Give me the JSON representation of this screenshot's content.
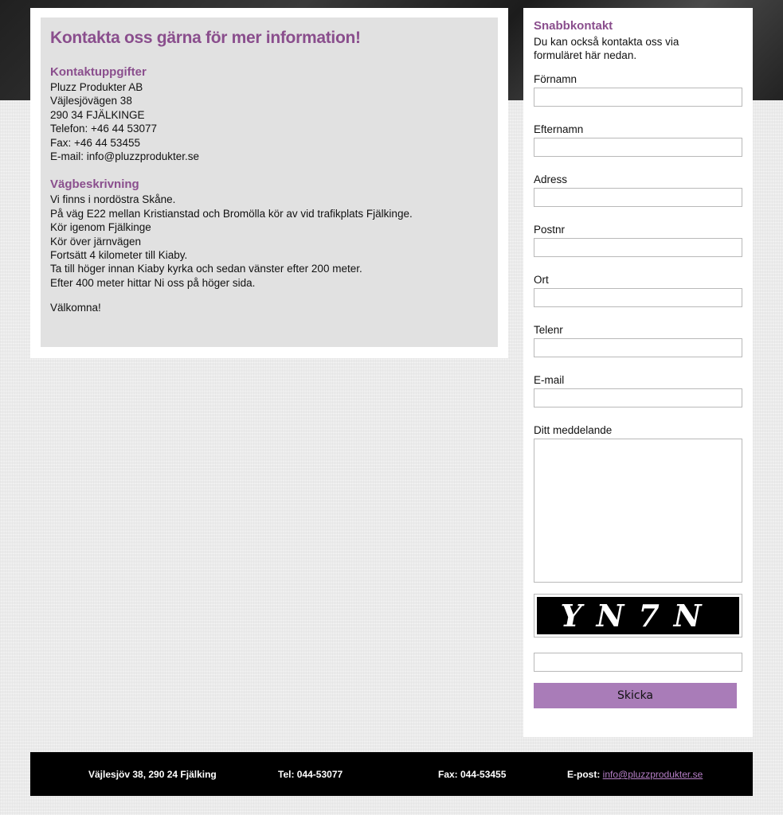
{
  "contact_info": {
    "title": "Kontakta oss gärna för mer information!",
    "details_heading": "Kontaktuppgifter",
    "details": [
      "Pluzz Produkter AB",
      "Väjlesjövägen 38",
      "290 34 FJÄLKINGE",
      "Telefon: +46 44 53077",
      "Fax: +46 44 53455",
      "E-mail: info@pluzzprodukter.se"
    ],
    "directions_heading": "Vägbeskrivning",
    "directions": [
      "Vi finns i nordöstra Skåne.",
      "På väg E22 mellan Kristianstad och Bromölla kör av vid trafikplats Fjälkinge.",
      "Kör igenom Fjälkinge",
      "Kör över järnvägen",
      "Fortsätt 4 kilometer till Kiaby.",
      "Ta till höger innan Kiaby kyrka och sedan vänster efter 200 meter.",
      "Efter 400 meter hittar Ni oss på höger sida."
    ],
    "welcome": "Välkomna!"
  },
  "quick_contact": {
    "title": "Snabbkontakt",
    "intro": "Du kan också kontakta oss via formuläret här nedan.",
    "fields": {
      "first_name": "Förnamn",
      "last_name": "Efternamn",
      "address": "Adress",
      "postal_code": "Postnr",
      "city": "Ort",
      "phone": "Telenr",
      "email": "E-mail",
      "message": "Ditt meddelande"
    },
    "captcha_text": "YN7N",
    "submit_label": "Skicka"
  },
  "footer": {
    "address": "Väjlesjöv 38, 290 24 Fjälking",
    "phone": "Tel: 044-53077",
    "fax": "Fax: 044-53455",
    "email_label": "E-post:",
    "email_link": "info@pluzzprodukter.se"
  },
  "colors": {
    "accent": "#8a4e8d",
    "button": "#a97cb8",
    "footer_bg": "#000000",
    "link": "#b67fc7"
  }
}
